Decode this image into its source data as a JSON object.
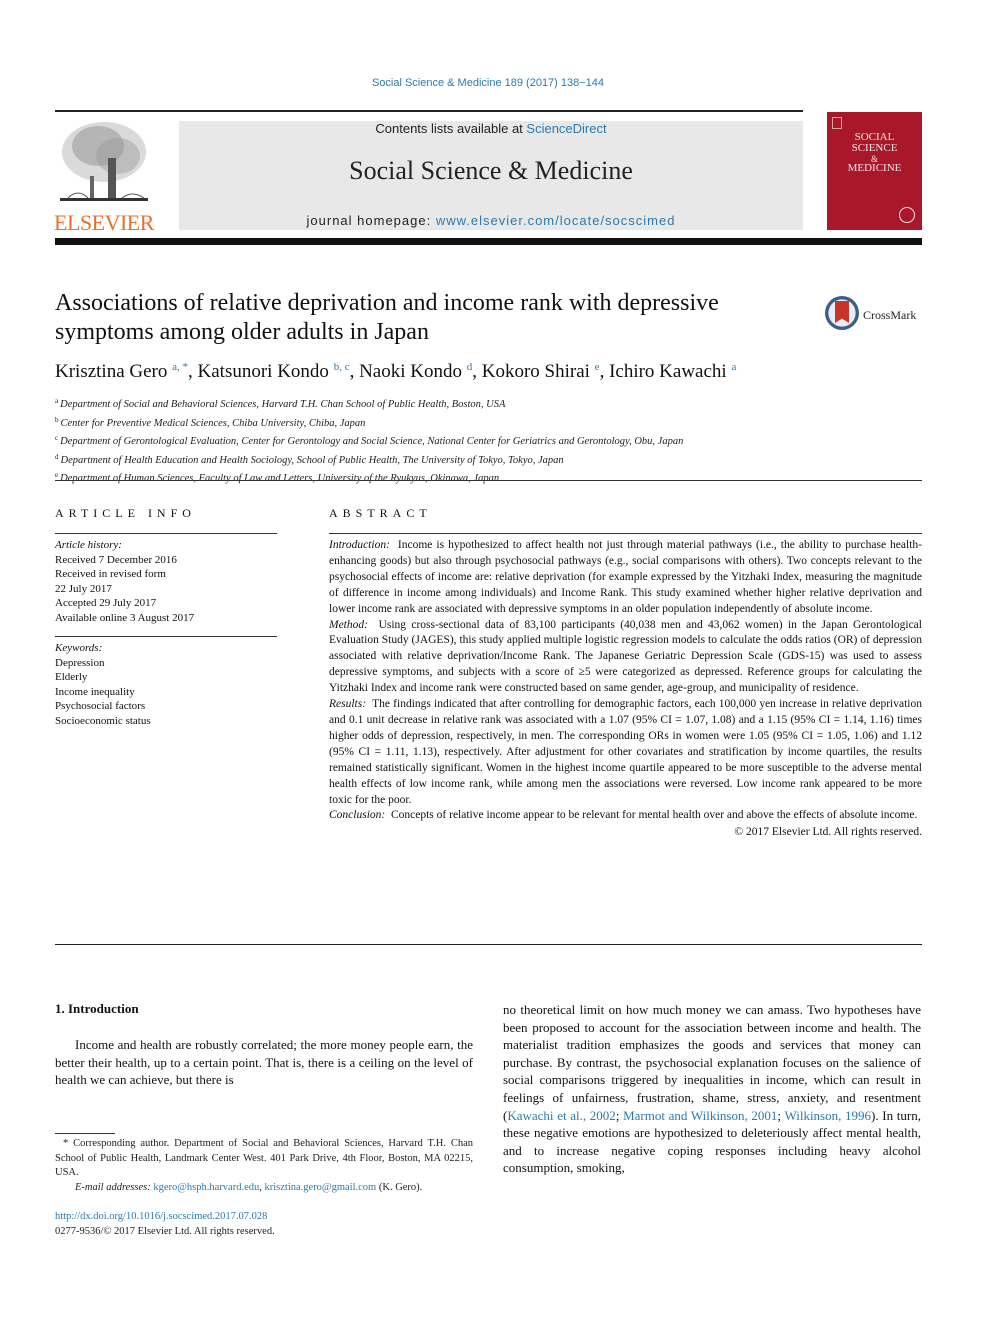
{
  "header": {
    "journal_ref": "Social Science & Medicine 189 (2017) 138−144",
    "contents_prefix": "Contents lists available at ",
    "contents_link": "ScienceDirect",
    "journal_title": "Social Science & Medicine",
    "homepage_prefix": "journal homepage: ",
    "homepage_link": "www.elsevier.com/locate/socscimed",
    "publisher_logo_text": "ELSEVIER",
    "cover": {
      "line1": "SOCIAL",
      "line2": "SCIENCE",
      "line3": "&",
      "line4": "MEDICINE"
    },
    "crossmark_label": "CrossMark"
  },
  "article": {
    "title": "Associations of relative deprivation and income rank with depressive symptoms among older adults in Japan",
    "authors": [
      {
        "name": "Krisztina Gero",
        "sup": "a, *"
      },
      {
        "name": "Katsunori Kondo",
        "sup": "b, c"
      },
      {
        "name": "Naoki Kondo",
        "sup": "d"
      },
      {
        "name": "Kokoro Shirai",
        "sup": "e"
      },
      {
        "name": "Ichiro Kawachi",
        "sup": "a"
      }
    ],
    "affiliations": [
      {
        "key": "a",
        "text": "Department of Social and Behavioral Sciences, Harvard T.H. Chan School of Public Health, Boston, USA"
      },
      {
        "key": "b",
        "text": "Center for Preventive Medical Sciences, Chiba University, Chiba, Japan"
      },
      {
        "key": "c",
        "text": "Department of Gerontological Evaluation, Center for Gerontology and Social Science, National Center for Geriatrics and Gerontology, Obu, Japan"
      },
      {
        "key": "d",
        "text": "Department of Health Education and Health Sociology, School of Public Health, The University of Tokyo, Tokyo, Japan"
      },
      {
        "key": "e",
        "text": "Department of Human Sciences, Faculty of Law and Letters, University of the Ryukyus, Okinawa, Japan"
      }
    ]
  },
  "article_info": {
    "heading": "ARTICLE INFO",
    "history_label": "Article history:",
    "history": [
      "Received 7 December 2016",
      "Received in revised form",
      "22 July 2017",
      "Accepted 29 July 2017",
      "Available online 3 August 2017"
    ],
    "keywords_label": "Keywords:",
    "keywords": [
      "Depression",
      "Elderly",
      "Income inequality",
      "Psychosocial factors",
      "Socioeconomic status"
    ]
  },
  "abstract": {
    "heading": "ABSTRACT",
    "sections": [
      {
        "label": "Introduction:",
        "text": "Income is hypothesized to affect health not just through material pathways (i.e., the ability to purchase health-enhancing goods) but also through psychosocial pathways (e.g., social comparisons with others). Two concepts relevant to the psychosocial effects of income are: relative deprivation (for example expressed by the Yitzhaki Index, measuring the magnitude of difference in income among individuals) and Income Rank. This study examined whether higher relative deprivation and lower income rank are associated with depressive symptoms in an older population independently of absolute income."
      },
      {
        "label": "Method:",
        "text": "Using cross-sectional data of 83,100 participants (40,038 men and 43,062 women) in the Japan Gerontological Evaluation Study (JAGES), this study applied multiple logistic regression models to calculate the odds ratios (OR) of depression associated with relative deprivation/Income Rank. The Japanese Geriatric Depression Scale (GDS-15) was used to assess depressive symptoms, and subjects with a score of ≥5 were categorized as depressed. Reference groups for calculating the Yitzhaki Index and income rank were constructed based on same gender, age-group, and municipality of residence."
      },
      {
        "label": "Results:",
        "text": "The findings indicated that after controlling for demographic factors, each 100,000 yen increase in relative deprivation and 0.1 unit decrease in relative rank was associated with a 1.07 (95% CI = 1.07, 1.08) and a 1.15 (95% CI = 1.14, 1.16) times higher odds of depression, respectively, in men. The corresponding ORs in women were 1.05 (95% CI = 1.05, 1.06) and 1.12 (95% CI = 1.11, 1.13), respectively. After adjustment for other covariates and stratification by income quartiles, the results remained statistically significant. Women in the highest income quartile appeared to be more susceptible to the adverse mental health effects of low income rank, while among men the associations were reversed. Low income rank appeared to be more toxic for the poor."
      },
      {
        "label": "Conclusion:",
        "text": "Concepts of relative income appear to be relevant for mental health over and above the effects of absolute income."
      }
    ],
    "copyright": "© 2017 Elsevier Ltd. All rights reserved."
  },
  "body": {
    "section_heading": "1.  Introduction",
    "left_paragraph": "Income and health are robustly correlated; the more money people earn, the better their health, up to a certain point. That is, there is a ceiling on the level of health we can achieve, but there is",
    "right_before_cite": "no theoretical limit on how much money we can amass. Two hypotheses have been proposed to account for the association between income and health. The materialist tradition emphasizes the goods and services that money can purchase. By contrast, the psychosocial explanation focuses on the salience of social comparisons triggered by inequalities in income, which can result in feelings of unfairness, frustration, shame, stress, anxiety, and resentment (",
    "citations": [
      "Kawachi et al., 2002",
      "Marmot and Wilkinson, 2001",
      "Wilkinson, 1996"
    ],
    "right_after_cite": "). In turn, these negative emotions are hypothesized to deleteriously affect mental health, and to increase negative coping responses including heavy alcohol consumption, smoking,"
  },
  "footnote": {
    "corresponding": "* Corresponding author. Department of Social and Behavioral Sciences, Harvard T.H. Chan School of Public Health, Landmark Center West. 401 Park Drive, 4th Floor, Boston, MA 02215, USA.",
    "email_label": "E-mail addresses:",
    "email1": "kgero@hsph.harvard.edu",
    "email2": "krisztina.gero@gmail.com",
    "email_suffix": " (K. Gero).",
    "doi": "http://dx.doi.org/10.1016/j.socscimed.2017.07.028",
    "issn": "0277-9536/© 2017 Elsevier Ltd. All rights reserved."
  }
}
